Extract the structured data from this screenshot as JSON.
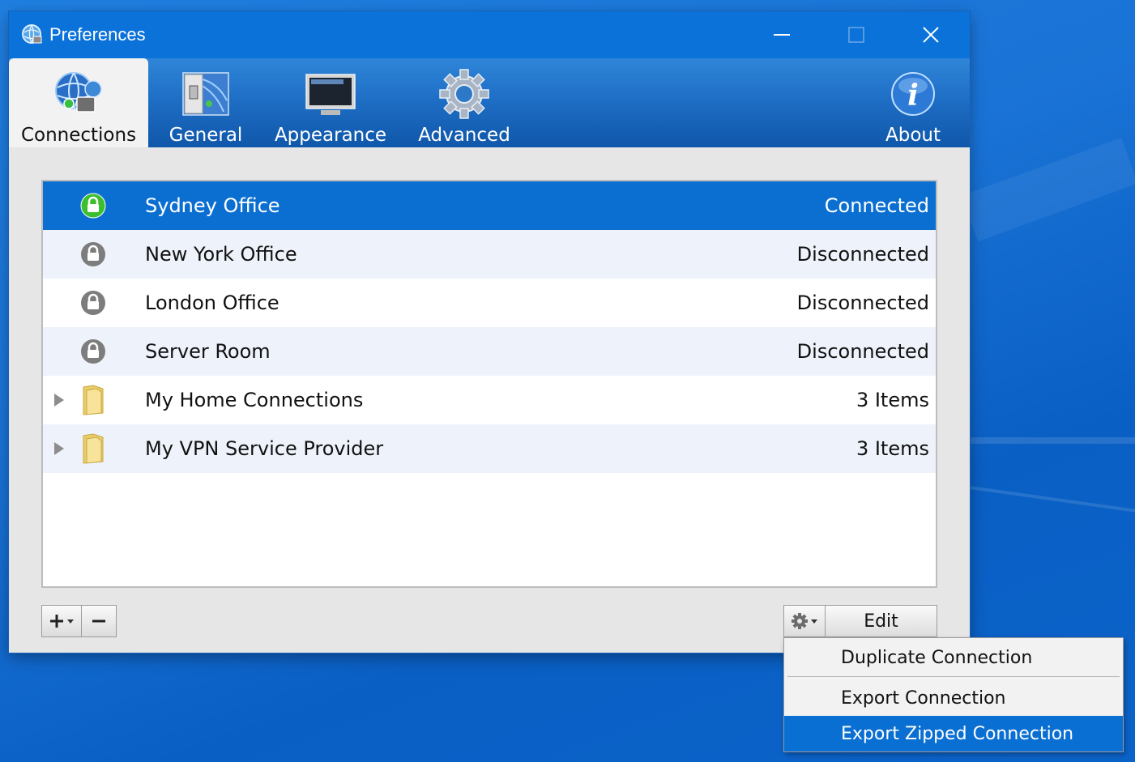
{
  "window": {
    "title": "Preferences"
  },
  "tabs": [
    {
      "label": "Connections",
      "icon": "connections-globe-icon",
      "active": true
    },
    {
      "label": "General",
      "icon": "general-switch-icon",
      "active": false
    },
    {
      "label": "Appearance",
      "icon": "appearance-monitor-icon",
      "active": false
    },
    {
      "label": "Advanced",
      "icon": "advanced-gear-icon",
      "active": false
    },
    {
      "label": "About",
      "icon": "about-info-icon",
      "active": false
    }
  ],
  "connections": [
    {
      "name": "Sydney Office",
      "status": "Connected",
      "icon": "lock-green-icon",
      "selected": true
    },
    {
      "name": "New York Office",
      "status": "Disconnected",
      "icon": "lock-gray-icon"
    },
    {
      "name": "London Office",
      "status": "Disconnected",
      "icon": "lock-gray-icon"
    },
    {
      "name": "Server Room",
      "status": "Disconnected",
      "icon": "lock-gray-icon"
    },
    {
      "name": "My Home Connections",
      "status": "3 Items",
      "icon": "folder-icon",
      "expandable": true
    },
    {
      "name": "My VPN Service Provider",
      "status": "3 Items",
      "icon": "folder-icon",
      "expandable": true
    }
  ],
  "buttons": {
    "edit": "Edit"
  },
  "context_menu": {
    "items": [
      "Duplicate Connection",
      "Export Connection",
      "Export Zipped Connection"
    ],
    "highlighted": "Export Zipped Connection"
  },
  "colors": {
    "accent": "#0b6fd2",
    "titlebar": "#0a72d8",
    "connected_lock": "#3cbf2f",
    "disconnected_lock": "#7d7d7d"
  }
}
